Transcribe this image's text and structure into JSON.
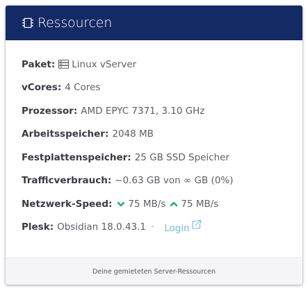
{
  "header": {
    "icon": "chip-icon",
    "title": "Ressourcen"
  },
  "rows": {
    "paket": {
      "label": "Paket:",
      "icon": "server-icon",
      "value": "Linux vServer"
    },
    "vcores": {
      "label": "vCores:",
      "value": "4 Cores"
    },
    "prozessor": {
      "label": "Prozessor:",
      "value": "AMD EPYC 7371, 3.10 GHz"
    },
    "arbeitsspeicher": {
      "label": "Arbeitsspeicher:",
      "value": "2048 MB"
    },
    "festplatte": {
      "label": "Festplattenspeicher:",
      "value": "25 GB SSD Speicher"
    },
    "traffic": {
      "label": "Trafficverbrauch:",
      "value": "~0.63 GB von ∞ GB (0%)"
    },
    "netzwerk": {
      "label": "Netzwerk-Speed:",
      "down_icon": "chevron-down-icon",
      "down_value": "75 MB/s",
      "up_icon": "chevron-up-icon",
      "up_value": "75 MB/s"
    },
    "plesk": {
      "label": "Plesk:",
      "value": "Obsidian 18.0.43.1",
      "separator": "·",
      "login_label": "Login",
      "login_icon": "external-link-icon"
    }
  },
  "footer": {
    "text": "Deine gemieteten Server-Ressourcen"
  },
  "colors": {
    "header_bg": "#142a64",
    "accent_green": "#21a67a",
    "link": "#6fb8d9"
  }
}
